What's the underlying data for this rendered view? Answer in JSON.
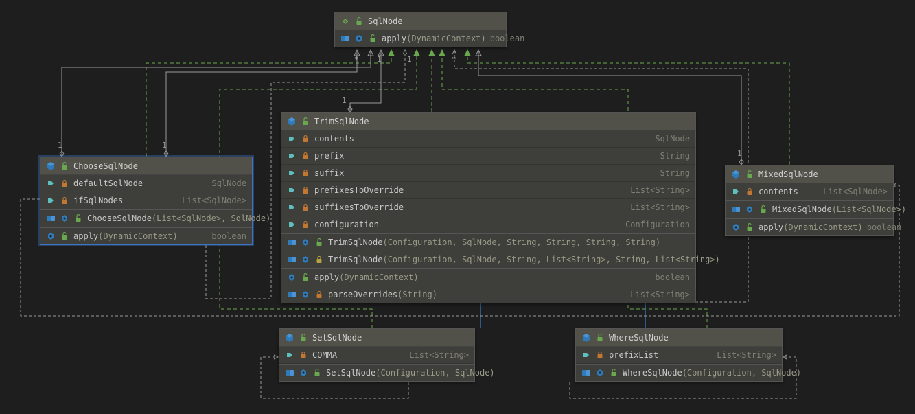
{
  "colors": {
    "interfaceIcon": "#6aa84f",
    "classIcon": "#2f7ab8",
    "lockClosed": "#c27832",
    "lockOpen": "#6aa84f",
    "fieldTag": "#5fbfbf",
    "methodIcon": "#2f7ab8"
  },
  "sqlNode": {
    "name": "SqlNode",
    "method": "apply",
    "methodParams": "(DynamicContext)",
    "methodType": "boolean"
  },
  "trim": {
    "name": "TrimSqlNode",
    "fields": [
      {
        "name": "contents",
        "type": "SqlNode"
      },
      {
        "name": "prefix",
        "type": "String"
      },
      {
        "name": "suffix",
        "type": "String"
      },
      {
        "name": "prefixesToOverride",
        "type": "List<String>"
      },
      {
        "name": "suffixesToOverride",
        "type": "List<String>"
      },
      {
        "name": "configuration",
        "type": "Configuration"
      }
    ],
    "ctor1": "TrimSqlNode",
    "ctor1Params": "(Configuration, SqlNode, String, String, String, String)",
    "ctor2": "TrimSqlNode",
    "ctor2Params": "(Configuration, SqlNode, String, List<String>, String, List<String>)",
    "m_apply": "apply",
    "m_applyParams": "(DynamicContext)",
    "m_applyType": "boolean",
    "m_parse": "parseOverrides",
    "m_parseParams": "(String)",
    "m_parseType": "List<String>"
  },
  "choose": {
    "name": "ChooseSqlNode",
    "f_default": "defaultSqlNode",
    "f_default_t": "SqlNode",
    "f_if": "ifSqlNodes",
    "f_if_t": "List<SqlNode>",
    "ctor": "ChooseSqlNode",
    "ctorParams": "(List<SqlNode>, SqlNode)",
    "m_apply": "apply",
    "m_applyParams": "(DynamicContext)",
    "m_applyType": "boolean"
  },
  "mixed": {
    "name": "MixedSqlNode",
    "f_contents": "contents",
    "f_contents_t": "List<SqlNode>",
    "ctor": "MixedSqlNode",
    "ctorParams": "(List<SqlNode>)",
    "m_apply": "apply",
    "m_applyParams": "(DynamicContext)",
    "m_applyType": "boolean"
  },
  "set": {
    "name": "SetSqlNode",
    "f_comma": "COMMA",
    "f_comma_t": "List<String>",
    "ctor": "SetSqlNode",
    "ctorParams": "(Configuration, SqlNode)"
  },
  "where": {
    "name": "WhereSqlNode",
    "f_prefix": "prefixList",
    "f_prefix_t": "List<String>",
    "ctor": "WhereSqlNode",
    "ctorParams": "(Configuration, SqlNode)"
  },
  "mult": {
    "one": "1",
    "star": "*"
  }
}
